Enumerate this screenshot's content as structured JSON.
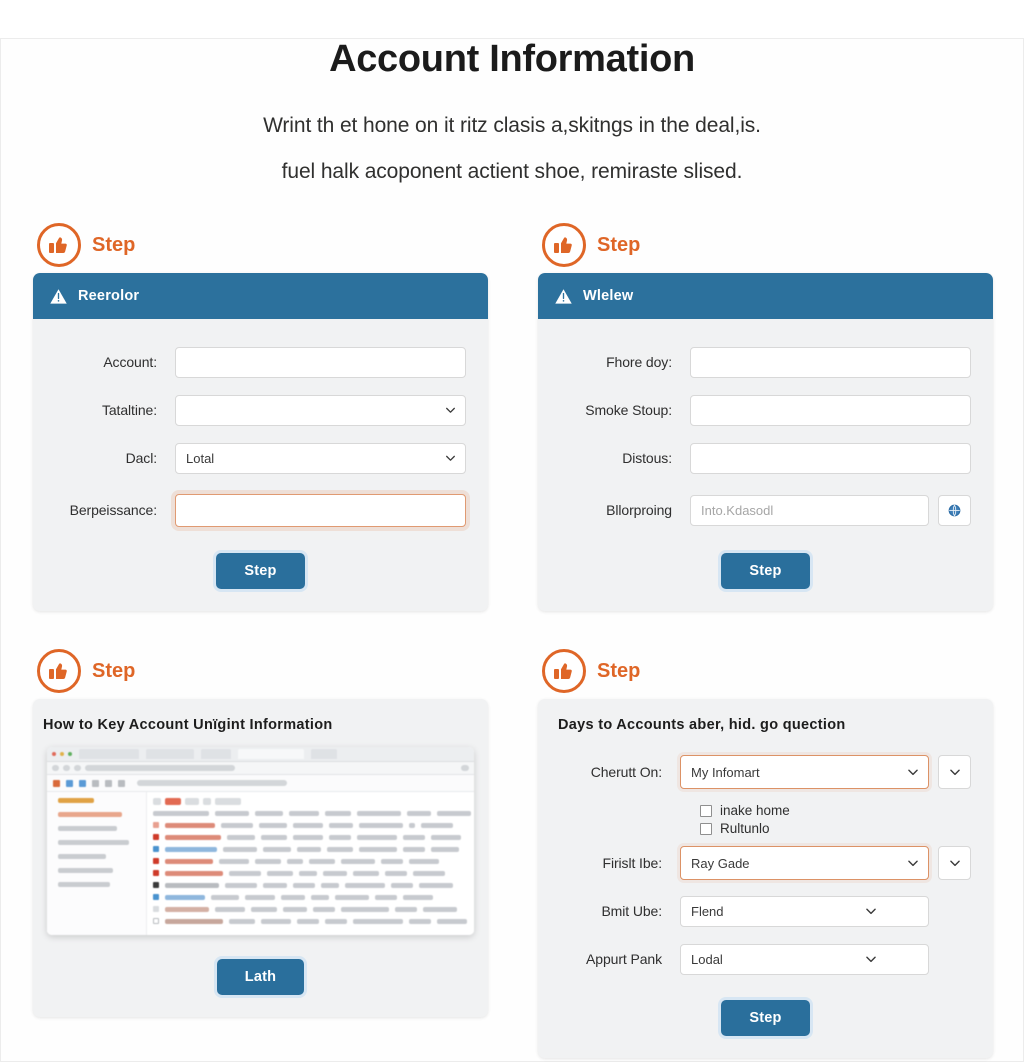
{
  "page": {
    "title": "Account Information",
    "subtitle_lines": [
      "Wrint th et hone on it ritz clasis a,skitngs in the deal,is.",
      "fuel halk acoponent actient shoe, remiraste slised."
    ],
    "colors": {
      "accent_orange": "#df6627",
      "header_blue": "#2c719d",
      "button_blue": "#2a6f9c",
      "card_bg": "#f1f2f3",
      "focus_orange": "#dc9266"
    }
  },
  "cards": [
    {
      "badge_label": "Step",
      "badge_icon": "thumbs-up-icon",
      "header_title": "Reerolor",
      "header_icon": "warning-triangle-icon",
      "fields": [
        {
          "label": "Account:",
          "type": "text",
          "value": "",
          "placeholder": ""
        },
        {
          "label": "Tataltine:",
          "type": "select",
          "value": ""
        },
        {
          "label": "Dacl:",
          "type": "select",
          "value": "Lotal"
        },
        {
          "label": "Berpeissance:",
          "type": "text-focused",
          "value": "",
          "placeholder": ""
        }
      ],
      "button_label": "Step"
    },
    {
      "badge_label": "Step",
      "badge_icon": "thumbs-up-icon",
      "header_title": "Wlelew",
      "header_icon": "warning-triangle-icon",
      "fields": [
        {
          "label": "Fhore doy:",
          "type": "text",
          "value": "",
          "placeholder": ""
        },
        {
          "label": "Smoke Stoup:",
          "type": "text",
          "value": "",
          "placeholder": ""
        },
        {
          "label": "Distous:",
          "type": "text",
          "value": "",
          "placeholder": ""
        },
        {
          "label": "Bllorproing",
          "type": "text-with-icon-button",
          "value": "",
          "placeholder": "Into.Kdasodl",
          "icon": "globe-search-icon"
        }
      ],
      "button_label": "Step"
    },
    {
      "badge_label": "Step",
      "badge_icon": "thumbs-up-icon",
      "body_heading": "How to Key Account Unïgint Information",
      "screenshot_alt": "browser-screenshot-thumbnail",
      "button_label": "Lath"
    },
    {
      "badge_label": "Step",
      "badge_icon": "thumbs-up-icon",
      "body_heading": "Days to Accounts aber, hid. go quection",
      "fields": [
        {
          "label": "Cherutt On:",
          "type": "select-focused-with-chevron",
          "value": "My Infomart"
        },
        {
          "label": "Firislt Ibe:",
          "type": "select-focused-with-chevron",
          "value": "Ray Gade"
        },
        {
          "label": "Bmit Ube:",
          "type": "select",
          "value": "Flend"
        },
        {
          "label": "Appurt Pank",
          "type": "select",
          "value": "Lodal"
        }
      ],
      "checkboxes": [
        {
          "label": "inake home",
          "checked": false
        },
        {
          "label": "Rultunlo",
          "checked": false
        }
      ],
      "button_label": "Step"
    }
  ]
}
